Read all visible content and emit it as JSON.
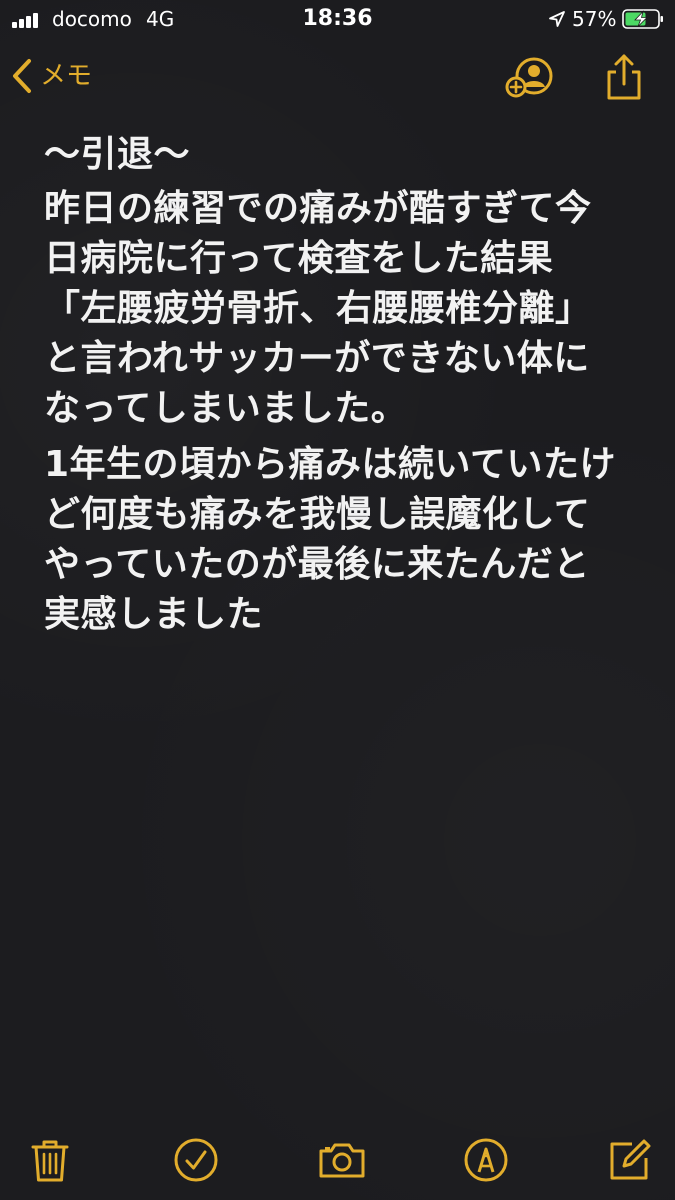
{
  "status_bar": {
    "carrier": "docomo",
    "network": "4G",
    "time": "18:36",
    "battery_percent": "57%"
  },
  "nav": {
    "back_label": "メモ",
    "back_icon": "chevron-left-icon",
    "collaborate_icon": "add-person-icon",
    "share_icon": "share-icon"
  },
  "note": {
    "title": "〜引退〜",
    "lines": [
      "昨日の練習での痛みが酷すぎて今",
      "日病院に行って検査をした結果",
      "「左腰疲労骨折、右腰腰椎分離」",
      "と言われサッカーができない体に",
      "なってしまいました。",
      "1年生の頃から痛みは続いていたけ",
      "ど何度も痛みを我慢し誤魔化して",
      "やっていたのが最後に来たんだと",
      "実感しました"
    ]
  },
  "toolbar": {
    "items": [
      "trash-icon",
      "checklist-icon",
      "camera-icon",
      "markup-icon",
      "compose-icon"
    ]
  },
  "colors": {
    "accent": "#e2ad2c",
    "background": "#1c1c1f",
    "text": "#f2f2f2"
  }
}
